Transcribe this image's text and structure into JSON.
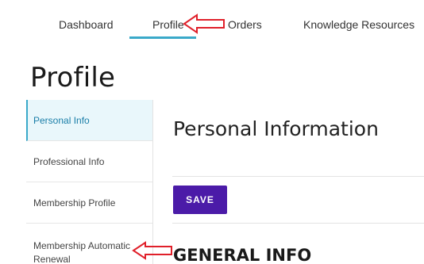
{
  "nav": {
    "items": [
      {
        "label": "Dashboard"
      },
      {
        "label": "Profile"
      },
      {
        "label": "Orders"
      },
      {
        "label": "Knowledge Resources"
      }
    ],
    "active_index": 1
  },
  "page": {
    "title": "Profile"
  },
  "sidebar": {
    "items": [
      {
        "label": "Personal Info",
        "active": true
      },
      {
        "label": "Professional Info"
      },
      {
        "label": "Membership Profile"
      },
      {
        "label": "Membership Automatic Renewal"
      }
    ]
  },
  "main": {
    "section_title": "Personal Information",
    "save_label": "SAVE",
    "subsection_title": "GENERAL INFO"
  },
  "annotations": {
    "arrow_icon": "left-arrow-annotation-icon",
    "color": "#e0202a"
  },
  "colors": {
    "accent": "#3aa9c9",
    "button": "#4b1ba8",
    "active_bg": "#e9f7fb"
  }
}
